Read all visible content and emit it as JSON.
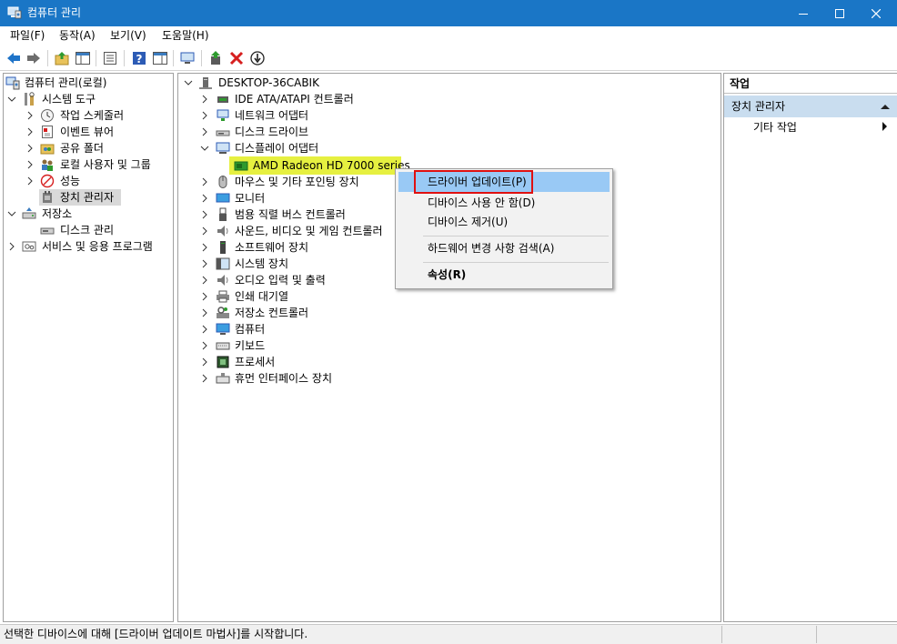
{
  "window": {
    "title": "컴퓨터 관리",
    "app_icon": "computer-management-icon",
    "controls": [
      "minimize-icon",
      "maximize-icon",
      "close-icon"
    ]
  },
  "menu": [
    "파일(F)",
    "동작(A)",
    "보기(V)",
    "도움말(H)"
  ],
  "toolbar": {
    "buttons": [
      "back-arrow-icon",
      "forward-arrow-icon",
      "up-folder-icon",
      "show-hide-tree-icon",
      "properties-icon",
      "help-icon",
      "show-action-pane-icon",
      "scan-hardware-icon",
      "update-driver-icon",
      "uninstall-icon",
      "disable-device-icon"
    ],
    "colors": {
      "back_arrow": "#1e73c8",
      "uninstall_x": "#d61f1f",
      "update_green": "#2e9a2e"
    }
  },
  "left_tree": {
    "root": "컴퓨터 관리(로컬)",
    "items": [
      "시스템 도구",
      "작업 스케줄러",
      "이벤트 뷰어",
      "공유 폴더",
      "로컬 사용자 및 그룹",
      "성능",
      "장치 관리자",
      "저장소",
      "디스크 관리",
      "서비스 및 응용 프로그램"
    ],
    "selected": "장치 관리자"
  },
  "device_tree": {
    "computer": "DESKTOP-36CABIK",
    "categories": [
      "IDE ATA/ATAPI 컨트롤러",
      "네트워크 어댑터",
      "디스크 드라이브",
      "디스플레이 어댑터",
      "AMD Radeon HD 7000 series",
      "마우스 및 기타 포인팅 장치",
      "모니터",
      "범용 직렬 버스 컨트롤러",
      "사운드, 비디오 및 게임 컨트롤러",
      "소프트웨어 장치",
      "시스템 장치",
      "오디오 입력 및 출력",
      "인쇄 대기열",
      "저장소 컨트롤러",
      "컴퓨터",
      "키보드",
      "프로세서",
      "휴먼 인터페이스 장치"
    ],
    "highlight_color": "#e6f040"
  },
  "context_menu": {
    "items": [
      "드라이버 업데이트(P)",
      "디바이스 사용 안 함(D)",
      "디바이스 제거(U)",
      "하드웨어 변경 사항 검색(A)",
      "속성(R)"
    ],
    "active_color": "#99c9f5",
    "annotation_color": "#e01010"
  },
  "actions_pane": {
    "title": "작업",
    "section": "장치 관리자",
    "item": "기타 작업"
  },
  "status": {
    "text": "선택한 디바이스에 대해 [드라이버 업데이트 마법사]를 시작합니다."
  }
}
